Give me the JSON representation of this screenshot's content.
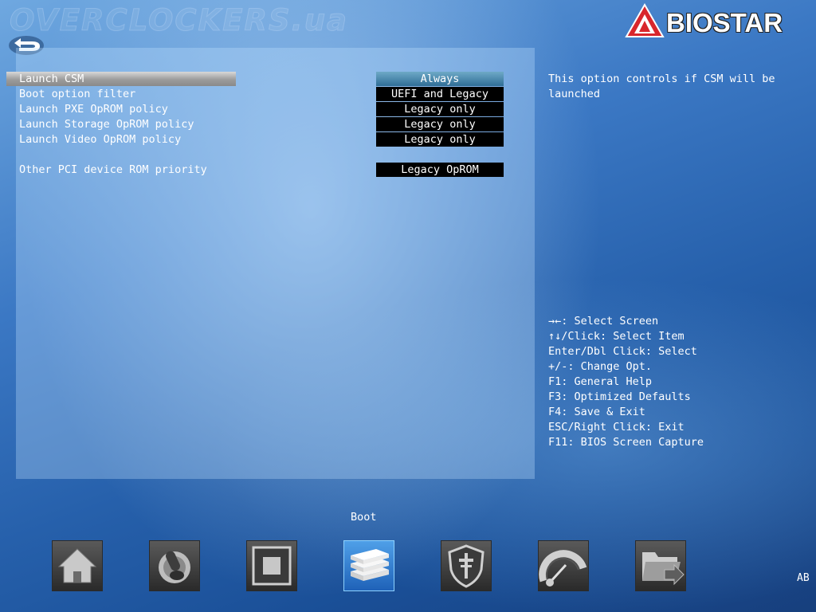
{
  "watermark": "OVERCLOCKERS.ua",
  "brand": {
    "logo_text": "BIOSTAR"
  },
  "settings": [
    {
      "label": "Launch CSM",
      "value": "Always",
      "selected": true
    },
    {
      "label": "Boot option filter",
      "value": "UEFI and Legacy"
    },
    {
      "label": "Launch PXE OpROM policy",
      "value": "Legacy only"
    },
    {
      "label": "Launch Storage OpROM policy",
      "value": "Legacy only"
    },
    {
      "label": "Launch Video OpROM policy",
      "value": "Legacy only"
    },
    {
      "label": "Other PCI device ROM priority",
      "value": "Legacy OpROM"
    }
  ],
  "help": {
    "line1": "This option controls if CSM will be",
    "line2": "launched"
  },
  "keys": [
    "→←: Select Screen",
    "↑↓/Click: Select Item",
    "Enter/Dbl Click: Select",
    "+/-: Change Opt.",
    "F1: General Help",
    "F3: Optimized Defaults",
    "F4: Save & Exit",
    "ESC/Right Click: Exit",
    "F11: BIOS Screen Capture"
  ],
  "section": {
    "label": "Boot"
  },
  "nav": [
    {
      "icon": "home-icon"
    },
    {
      "icon": "joystick-icon"
    },
    {
      "icon": "chip-icon"
    },
    {
      "icon": "boot-drives-icon",
      "active": true
    },
    {
      "icon": "security-shield-icon"
    },
    {
      "icon": "speedometer-icon"
    },
    {
      "icon": "folder-exit-icon"
    }
  ],
  "language": "AB",
  "colors": {
    "selected_value": "#3a82aa",
    "value_bg": "#000000",
    "active_nav": "#2f7fd6",
    "logo_red": "#d8262c"
  }
}
